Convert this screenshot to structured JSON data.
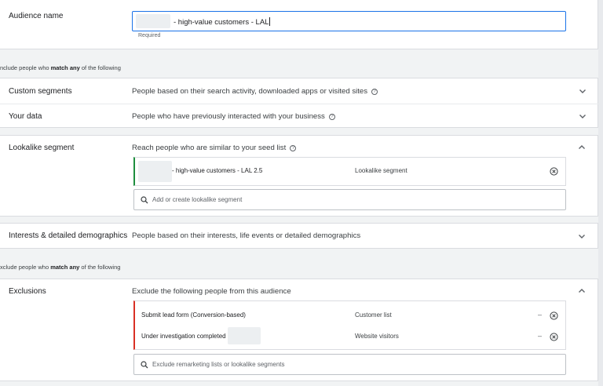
{
  "audience_name": {
    "label": "Audience name",
    "value": "- high-value customers - LAL",
    "helper": "Required"
  },
  "include_caption": {
    "prefix": "nclude people who ",
    "emphasis": "match any",
    "suffix": " of the following"
  },
  "include_rows": {
    "custom_segments": {
      "label": "Custom segments",
      "description": "People based on their search activity, downloaded apps or visited sites"
    },
    "your_data": {
      "label": "Your data",
      "description": "People who have previously interacted with your business"
    },
    "lookalike": {
      "label": "Lookalike segment",
      "description": "Reach people who are similar to your seed list",
      "selected": {
        "name": "- high-value customers - LAL 2.5",
        "type": "Lookalike segment"
      },
      "search_placeholder": "Add or create lookalike segment"
    },
    "interests": {
      "label": "Interests & detailed demographics",
      "description": "People based on their interests, life events or detailed demographics"
    }
  },
  "exclude_caption": {
    "prefix": "xclude people who ",
    "emphasis": "match any",
    "suffix": " of the following"
  },
  "exclusions": {
    "label": "Exclusions",
    "description": "Exclude the following people from this audience",
    "items": [
      {
        "name": "Submit lead form (Conversion-based)",
        "type": "Customer list",
        "dash": "–"
      },
      {
        "name": "Under investigation completed",
        "type": "Website visitors",
        "dash": "–"
      }
    ],
    "search_placeholder": "Exclude remarketing lists or lookalike segments"
  },
  "icons": {
    "help": "help-circle-icon",
    "expand": "chevron-down-icon",
    "collapse": "chevron-up-icon",
    "remove": "close-circle-icon",
    "search": "search-icon"
  },
  "colors": {
    "focus_blue": "#1a73e8",
    "include_green": "#1e8e3e",
    "exclude_red": "#d93025"
  }
}
